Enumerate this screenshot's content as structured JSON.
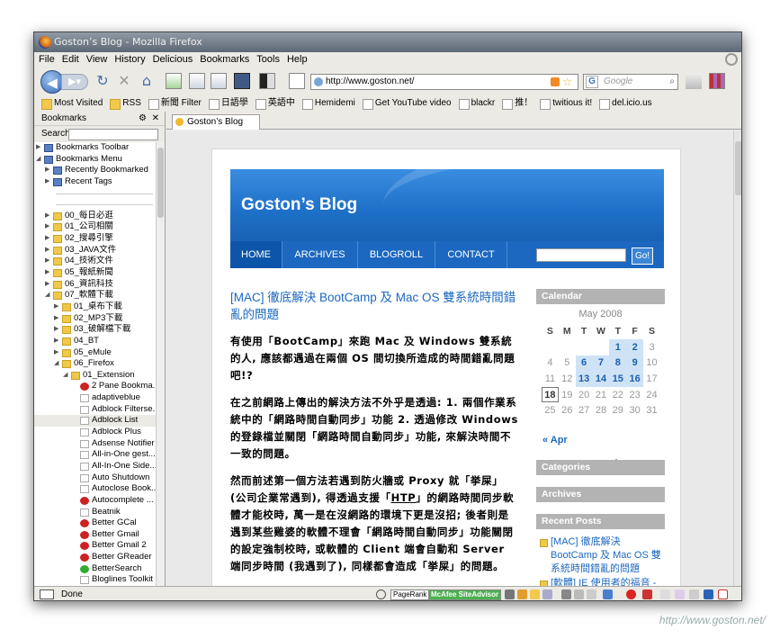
{
  "window": {
    "title": "Goston’s Blog - Mozilla Firefox"
  },
  "menu": [
    "File",
    "Edit",
    "View",
    "History",
    "Delicious",
    "Bookmarks",
    "Tools",
    "Help"
  ],
  "nav": {
    "url": "http://www.goston.net/",
    "search_placeholder": "Google",
    "search_engine_icon": "G"
  },
  "bookmarks_bar": [
    "Most Visited",
    "RSS",
    "新聞 Filter",
    "日語學",
    "英語中",
    "Hemidemi",
    "Get YouTube video",
    "blackr",
    "推！",
    "twitious it!",
    "del.icio.us"
  ],
  "sidebar": {
    "title": "Bookmarks",
    "search_label": "Search:",
    "items": [
      {
        "label": "Bookmarks Toolbar",
        "depth": 0,
        "type": "bt",
        "tw": "▶"
      },
      {
        "label": "Bookmarks Menu",
        "depth": 0,
        "type": "bt",
        "tw": "◢"
      },
      {
        "label": "Recently Bookmarked",
        "depth": 1,
        "type": "bt",
        "tw": "▶"
      },
      {
        "label": "Recent Tags",
        "depth": 1,
        "type": "bt",
        "tw": "▶"
      },
      {
        "label": "",
        "depth": 1,
        "type": "sep",
        "tw": ""
      },
      {
        "label": "",
        "depth": 1,
        "type": "sep",
        "tw": ""
      },
      {
        "label": "00_每日必逛",
        "depth": 1,
        "type": "fold",
        "tw": "▶"
      },
      {
        "label": "01_公司相關",
        "depth": 1,
        "type": "fold",
        "tw": "▶"
      },
      {
        "label": "02_搜尋引擎",
        "depth": 1,
        "type": "fold",
        "tw": "▶"
      },
      {
        "label": "03_JAVA文件",
        "depth": 1,
        "type": "fold",
        "tw": "▶"
      },
      {
        "label": "04_技術文件",
        "depth": 1,
        "type": "fold",
        "tw": "▶"
      },
      {
        "label": "05_報紙新聞",
        "depth": 1,
        "type": "fold",
        "tw": "▶"
      },
      {
        "label": "06_資訊科技",
        "depth": 1,
        "type": "fold",
        "tw": "▶"
      },
      {
        "label": "07_軟體下載",
        "depth": 1,
        "type": "fold",
        "tw": "◢"
      },
      {
        "label": "01_桌布下載",
        "depth": 2,
        "type": "fold",
        "tw": "▶"
      },
      {
        "label": "02_MP3下載",
        "depth": 2,
        "type": "fold",
        "tw": "▶"
      },
      {
        "label": "03_破解檔下載",
        "depth": 2,
        "type": "fold",
        "tw": "▶"
      },
      {
        "label": "04_BT",
        "depth": 2,
        "type": "fold",
        "tw": "▶"
      },
      {
        "label": "05_eMule",
        "depth": 2,
        "type": "fold",
        "tw": "▶"
      },
      {
        "label": "06_Firefox",
        "depth": 2,
        "type": "fold",
        "tw": "◢"
      },
      {
        "label": "01_Extension",
        "depth": 3,
        "type": "fold",
        "tw": "◢"
      },
      {
        "label": "2 Pane Bookma...",
        "depth": 4,
        "type": "red",
        "tw": ""
      },
      {
        "label": "adaptiveblue",
        "depth": 4,
        "type": "pg",
        "tw": ""
      },
      {
        "label": "Adblock Filterse...",
        "depth": 4,
        "type": "pg",
        "tw": ""
      },
      {
        "label": "Adblock List",
        "depth": 4,
        "type": "pg",
        "tw": "",
        "sel": true
      },
      {
        "label": "Adblock Plus",
        "depth": 4,
        "type": "pg",
        "tw": ""
      },
      {
        "label": "Adsense Notifier",
        "depth": 4,
        "type": "pg",
        "tw": ""
      },
      {
        "label": "All-in-One gest...",
        "depth": 4,
        "type": "pg",
        "tw": ""
      },
      {
        "label": "All-In-One Side...",
        "depth": 4,
        "type": "pg",
        "tw": ""
      },
      {
        "label": "Auto Shutdown",
        "depth": 4,
        "type": "pg",
        "tw": ""
      },
      {
        "label": "Autoclose Book...",
        "depth": 4,
        "type": "pg",
        "tw": ""
      },
      {
        "label": "Autocomplete ...",
        "depth": 4,
        "type": "red",
        "tw": ""
      },
      {
        "label": "Beatnik",
        "depth": 4,
        "type": "pg",
        "tw": ""
      },
      {
        "label": "Better GCal",
        "depth": 4,
        "type": "red",
        "tw": ""
      },
      {
        "label": "Better Gmail",
        "depth": 4,
        "type": "red",
        "tw": ""
      },
      {
        "label": "Better Gmail 2",
        "depth": 4,
        "type": "red",
        "tw": ""
      },
      {
        "label": "Better GReader",
        "depth": 4,
        "type": "red",
        "tw": ""
      },
      {
        "label": "BetterSearch",
        "depth": 4,
        "type": "grn",
        "tw": ""
      },
      {
        "label": "Bloglines Toolkit",
        "depth": 4,
        "type": "pg",
        "tw": ""
      }
    ]
  },
  "tab": {
    "label": "Goston’s Blog"
  },
  "blog": {
    "title": "Goston’s Blog",
    "nav": [
      "HOME",
      "ARCHIVES",
      "BLOGROLL",
      "CONTACT"
    ],
    "go_label": "Go!",
    "post_title": "[MAC] 徹底解決 BootCamp 及 Mac OS 雙系統時間錯亂的問題",
    "p1": "有使用「BootCamp」來跑 Mac 及 Windows 雙系統的人, 應該都遇過在兩個 OS 間切換所造成的時間錯亂問題吧!?",
    "p2": "在之前網路上傳出的解決方法不外乎是透過: 1. 兩個作業系統中的「網路時間自動同步」功能 2. 透過修改 Windows 的登錄檔並關閉「網路時間自動同步」功能, 來解決時間不一致的問題。",
    "p3a": "然而前述第一個方法若遇到防火牆或 Proxy 就「挙屎」(公司企業常遇到), 得透過支援「",
    "p3link": "HTP",
    "p3b": "」的網路時間同步軟體才能校時, 萬一是在沒網路的環境下更是沒招; 後者則是遇到某些雞婆的軟體不理會「網路時間自動同步」功能關閉的設定強制校時, 或軟體的 Client 端會自動和 Server 端同步時間 (我遇到了), 同樣都會造成「挙屎」的問題。",
    "sidebar": {
      "calendar_title": "Calendar",
      "month": "May 2008",
      "weekdays": [
        "S",
        "M",
        "T",
        "W",
        "T",
        "F",
        "S"
      ],
      "weeks": [
        [
          "",
          "",
          "",
          "",
          "1",
          "2",
          "3"
        ],
        [
          "4",
          "5",
          "6",
          "7",
          "8",
          "9",
          "10"
        ],
        [
          "11",
          "12",
          "13",
          "14",
          "15",
          "16",
          "17"
        ],
        [
          "18",
          "19",
          "20",
          "21",
          "22",
          "23",
          "24"
        ],
        [
          "25",
          "26",
          "27",
          "28",
          "29",
          "30",
          "31"
        ]
      ],
      "highlight_days": [
        "1",
        "2",
        "6",
        "7",
        "8",
        "9",
        "13",
        "14",
        "15",
        "16"
      ],
      "today": "18",
      "prev_label": "« Apr",
      "categories": "Categories",
      "archives": "Archives",
      "recent_posts": "Recent Posts",
      "recent1": "[MAC] 徹底解決 BootCamp 及 Mac OS 雙系統時間錯亂的問題",
      "recent2": "[軟體] IE 使用者的福音 -"
    }
  },
  "status": {
    "text": "Done",
    "pagerank": "PageRank",
    "siteadvisor": "McAfee SiteAdvisor"
  },
  "watermark": "http://www.goston.net/"
}
